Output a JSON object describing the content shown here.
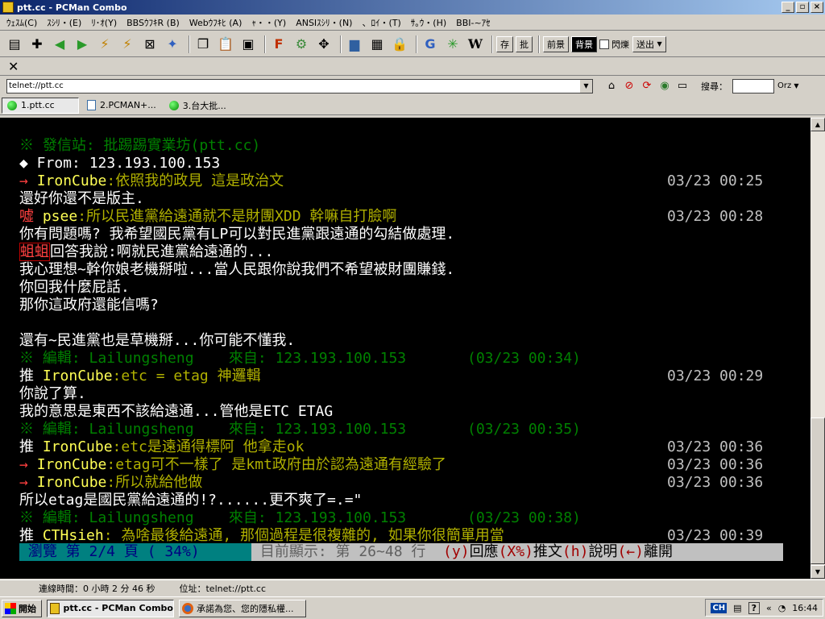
{
  "window": {
    "title": "ptt.cc - PCMan Combo"
  },
  "menu": [
    "ｳｪｽﾑ(C)",
    "ｽｼﾘ・(E)",
    "ﾘ･ｵ(Y)",
    "BBSｳﾌｷR (B)",
    "Webｳﾌｷﾋ (A)",
    "ｬ・・(Y)",
    "ANSIｽｼﾘ・(N)",
    "、ﾛｲ・(T)",
    "ｻ｡ｳ・(H)",
    "BBI-~ｱｾ"
  ],
  "toolbar": {
    "prev_label": "前景",
    "bg_label": "背景",
    "blink_label": "閃爍",
    "send_label": "送出",
    "save_label": "存",
    "batch_label": "批"
  },
  "address": {
    "value": "telnet://ptt.cc"
  },
  "search": {
    "label": "搜尋：",
    "value": "",
    "engine": "Orz"
  },
  "tabs": [
    "1.ptt.cc",
    "2.PCMAN+...",
    "3.台大批..."
  ],
  "terminal": {
    "lines": [
      {
        "parts": [
          [
            "c-green",
            "※ 發信站: 批踢踢實業坊(ptt.cc)"
          ]
        ]
      },
      {
        "parts": [
          [
            "c-bwhite",
            "◆ From: 123.193.100.153"
          ]
        ]
      },
      {
        "parts": [
          [
            "c-bred",
            "→ "
          ],
          [
            "c-byellow",
            "IronCube"
          ],
          [
            "c-yellow",
            ":依照我的政見 這是政治文"
          ]
        ],
        "time": "03/23 00:25"
      },
      {
        "parts": [
          [
            "c-bwhite",
            "還好你還不是版主."
          ]
        ]
      },
      {
        "parts": [
          [
            "c-bred",
            "噓 "
          ],
          [
            "c-byellow",
            "psee"
          ],
          [
            "c-yellow",
            ":所以民進黨給遠通就不是財團XDD 幹嘛自打臉啊"
          ]
        ],
        "time": "03/23 00:28"
      },
      {
        "parts": [
          [
            "c-bwhite",
            "你有問題嗎? 我希望國民黨有LP可以對民進黨跟遠通的勾結做處理."
          ]
        ]
      },
      {
        "parts": [
          [
            "boxed",
            "蛆蛆"
          ],
          [
            "c-bwhite",
            "回答我說:啊就民進黨給遠通的..."
          ]
        ]
      },
      {
        "parts": [
          [
            "c-bwhite",
            "我心理想~幹你娘老機掰啦...當人民跟你說我們不希望被財團賺錢."
          ]
        ]
      },
      {
        "parts": [
          [
            "c-bwhite",
            "你回我什麼屁話."
          ]
        ]
      },
      {
        "parts": [
          [
            "c-bwhite",
            "那你這政府還能信嗎?"
          ]
        ]
      },
      {
        "parts": [
          [
            "c-bwhite",
            ""
          ]
        ]
      },
      {
        "parts": [
          [
            "c-bwhite",
            "還有~民進黨也是草機掰...你可能不懂我."
          ]
        ]
      },
      {
        "parts": [
          [
            "c-green",
            "※ 編輯: Lailungsheng    來自: 123.193.100.153       (03/23 00:34)"
          ]
        ]
      },
      {
        "parts": [
          [
            "c-bwhite",
            "推 "
          ],
          [
            "c-byellow",
            "IronCube"
          ],
          [
            "c-yellow",
            ":etc = etag 神邏輯"
          ]
        ],
        "time": "03/23 00:29"
      },
      {
        "parts": [
          [
            "c-bwhite",
            "你說了算."
          ]
        ]
      },
      {
        "parts": [
          [
            "c-bwhite",
            "我的意思是東西不該給遠通...管他是ETC ETAG"
          ]
        ]
      },
      {
        "parts": [
          [
            "c-green",
            "※ 編輯: Lailungsheng    來自: 123.193.100.153       (03/23 00:35)"
          ]
        ]
      },
      {
        "parts": [
          [
            "c-bwhite",
            "推 "
          ],
          [
            "c-byellow",
            "IronCube"
          ],
          [
            "c-yellow",
            ":etc是遠通得標阿 他拿走ok"
          ]
        ],
        "time": "03/23 00:36"
      },
      {
        "parts": [
          [
            "c-bred",
            "→ "
          ],
          [
            "c-byellow",
            "IronCube"
          ],
          [
            "c-yellow",
            ":etag可不一樣了 是kmt政府由於認為遠通有經驗了"
          ]
        ],
        "time": "03/23 00:36"
      },
      {
        "parts": [
          [
            "c-bred",
            "→ "
          ],
          [
            "c-byellow",
            "IronCube"
          ],
          [
            "c-yellow",
            ":所以就給他做"
          ]
        ],
        "time": "03/23 00:36"
      },
      {
        "parts": [
          [
            "c-bwhite",
            "所以etag是國民黨給遠通的!?......更不爽了=.=\""
          ]
        ]
      },
      {
        "parts": [
          [
            "c-green",
            "※ 編輯: Lailungsheng    來自: 123.193.100.153       (03/23 00:38)"
          ]
        ]
      },
      {
        "parts": [
          [
            "c-bwhite",
            "推 "
          ],
          [
            "c-byellow",
            "CTHsieh"
          ],
          [
            "c-yellow",
            ": 為啥最後給遠通, 那個過程是很複雜的, 如果你很簡單用當"
          ]
        ],
        "time": "03/23 00:39"
      }
    ],
    "footer": {
      "browse": " 瀏覽 第 2/4 頁 ( 34%) ",
      "showing": " 目前顯示: 第 26~48 行  ",
      "help": [
        [
          "st-c",
          "(y)"
        ],
        [
          "st-d",
          "回應"
        ],
        [
          "st-c",
          "(X%)"
        ],
        [
          "st-d",
          "推文"
        ],
        [
          "st-c",
          "(h)"
        ],
        [
          "st-d",
          "說明"
        ],
        [
          "st-c",
          "(←)"
        ],
        [
          "st-d",
          "離開"
        ]
      ]
    }
  },
  "appstatus": {
    "conn_time": "連線時間：0 小時 2 分 46 秒",
    "address": "位址：telnet://ptt.cc"
  },
  "taskbar": {
    "start_label": "開始",
    "tasks": [
      "ptt.cc - PCMan Combo",
      "承諾為您、您的隱私權..."
    ],
    "ime": "CH",
    "clock": "16:44"
  }
}
